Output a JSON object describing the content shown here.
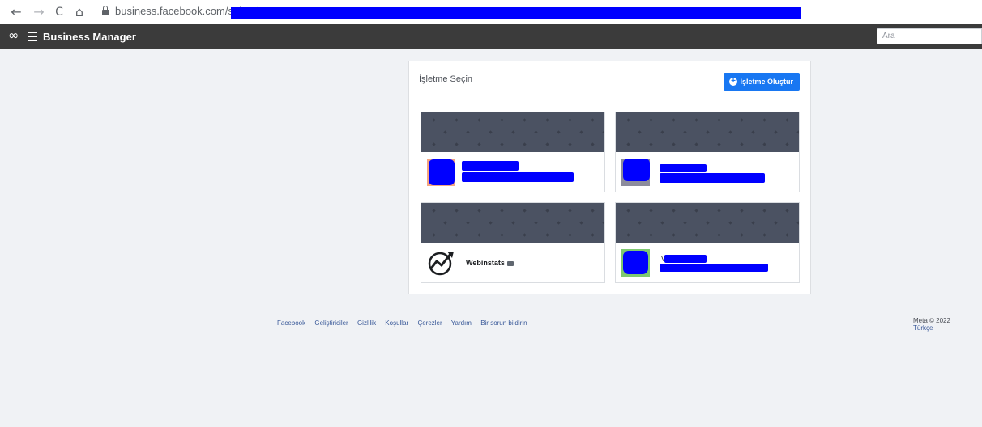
{
  "browser": {
    "back_icon": "←",
    "forward_icon": "→",
    "reload_icon": "C",
    "home_icon": "⌂",
    "url": "business.facebook.com/select/?"
  },
  "topbar": {
    "logo_icon": "∞",
    "brand": "Business Manager",
    "search_placeholder": "Ara"
  },
  "panel": {
    "title": "İşletme Seçin",
    "create_button": "İşletme Oluştur",
    "create_icon": "+"
  },
  "cards": [
    {
      "name": "",
      "avatar_color": "#f4a582",
      "redacted": true
    },
    {
      "name": "",
      "avatar_color": "#8c8c9c",
      "redacted": true
    },
    {
      "name": "Webinstats",
      "avatar_color": "#ffffff",
      "redacted": false
    },
    {
      "name": "V",
      "avatar_color": "#7ec870",
      "redacted": true
    }
  ],
  "footer": {
    "links": [
      "Facebook",
      "Geliştiriciler",
      "Gizlilik",
      "Koşullar",
      "Çerezler",
      "Yardım",
      "Bir sorun bildirin"
    ],
    "copyright": "Meta © 2022",
    "language": "Türkçe"
  },
  "colors": {
    "accent": "#1877f2",
    "topbar": "#3b3b3b",
    "cover": "#4b5262",
    "redaction": "#0000ff"
  }
}
